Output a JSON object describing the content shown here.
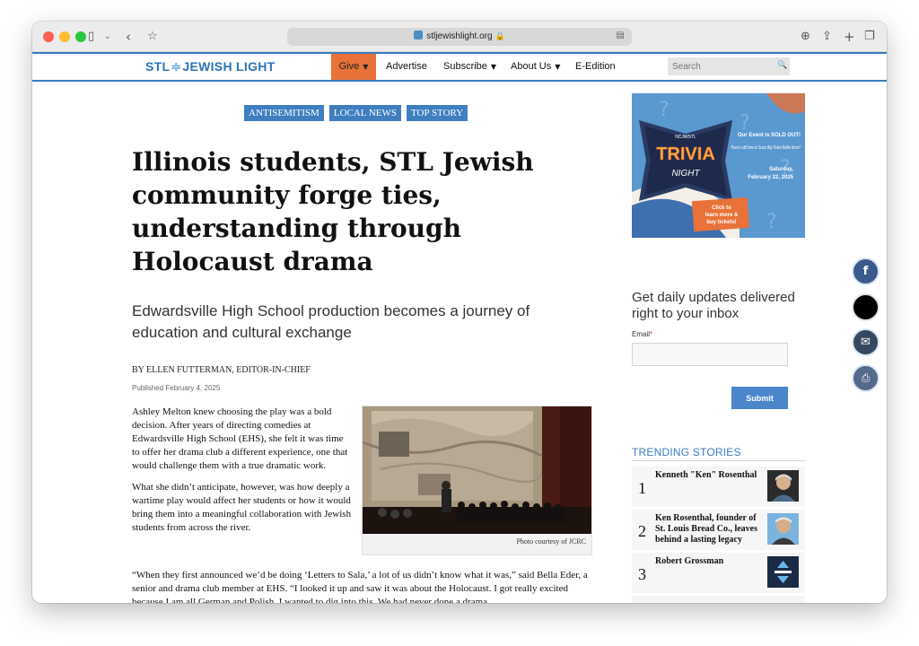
{
  "browser": {
    "url": "stljewishlight.org",
    "lock_icon": "lock-icon",
    "reader_icon": "reader-icon"
  },
  "site": {
    "logo": "STL JEWISH LIGHT",
    "logo_left": "STL",
    "logo_right": "JEWISH LIGHT",
    "nav": {
      "give": "Give",
      "advertise": "Advertise",
      "subscribe": "Subscribe",
      "about": "About Us",
      "edition": "E-Edition"
    },
    "search_placeholder": "Search",
    "accent": "#3b7bbf",
    "give_color": "#e8723a"
  },
  "article": {
    "tags": [
      "ANTISEMITISM",
      "LOCAL NEWS",
      "TOP STORY"
    ],
    "headline": "Illinois students, STL Jewish community forge ties, understanding through Holocaust drama",
    "subhead": "Edwardsville High School production becomes a journey of education and cultural exchange",
    "byline": "BY ELLEN FUTTERMAN, EDITOR-IN-CHIEF",
    "published": "Published February 4, 2025",
    "para1": "Ashley Melton knew choosing the play was a bold decision. After years of directing comedies at Edwardsville High School (EHS), she felt it was time to offer her drama club a different experience, one that would challenge them with a true dramatic work.",
    "para2": "What she didn’t anticipate, however, was how deeply a wartime play would affect her students or how it would bring them into a meaningful collaboration with Jewish students from across the river.",
    "para3": "“When they first announced we’d be doing ‘Letters to Sala,’ a lot of us didn’t know what it was,” said Bella Eder, a senior and drama club member at EHS. “I looked it up and saw it was about the Holocaust. I got really excited because I am all German and Polish. I wanted to dig into this. We had never done a drama",
    "photo_caption": "Photo courtesy of JCRC"
  },
  "sidebar": {
    "ad": {
      "small_top": "NCJWSTL",
      "title1": "TRIVIA",
      "title2": "NIGHT",
      "sold_out": "Our Event is SOLD OUT!",
      "raffle": "There’s still time to Score Big-Ticket Raffle Items*",
      "date1": "Saturday,",
      "date2": "February 22, 2025",
      "cta1": "Click to",
      "cta2": "learn more &",
      "cta3": "buy tickets!"
    },
    "newsletter": {
      "title": "Get daily updates delivered right to your inbox",
      "email_label": "Email",
      "required_mark": "*",
      "submit": "Submit"
    },
    "trending_title": "TRENDING STORIES",
    "trending": [
      {
        "num": "1",
        "title": "Kenneth \"Ken\" Rosenthal"
      },
      {
        "num": "2",
        "title": "Ken Rosenthal, founder of St. Louis Bread Co., leaves behind a lasting legacy"
      },
      {
        "num": "3",
        "title": "Robert Grossman"
      }
    ]
  },
  "share": {
    "facebook": "f",
    "facebook_icon": "facebook-icon",
    "x_icon": "x-icon",
    "email_icon": "email-icon",
    "print_icon": "print-icon"
  }
}
